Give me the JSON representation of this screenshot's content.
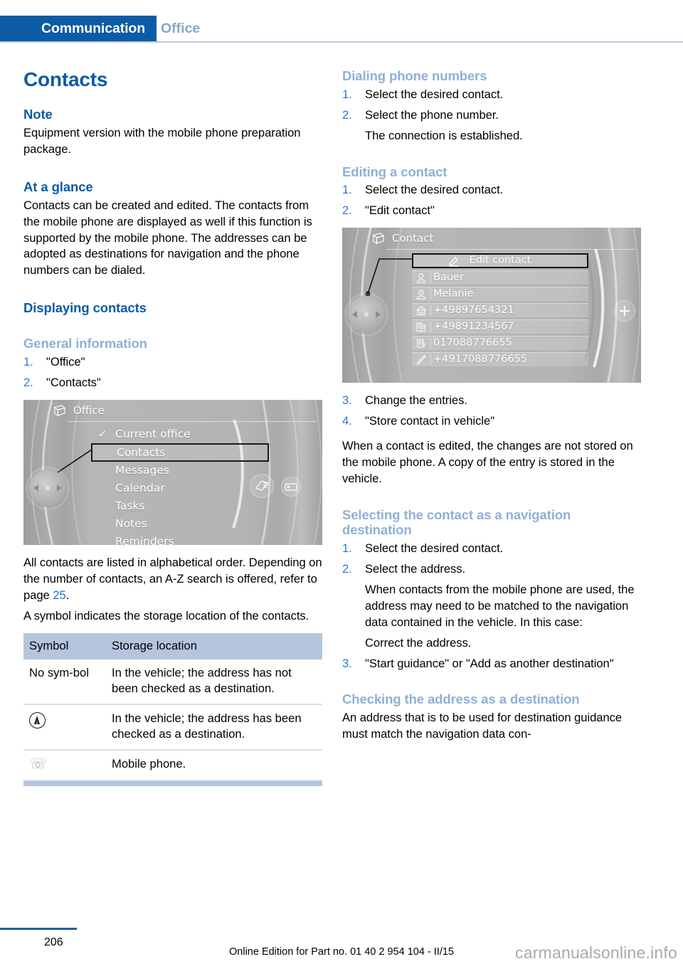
{
  "header": {
    "active_tab": "Communication",
    "inactive_tab": "Office",
    "accent_color": "#0b5ba5",
    "inactive_color": "#8ba6c9"
  },
  "left_column": {
    "title": "Contacts",
    "note_heading": "Note",
    "note_text": "Equipment version with the mobile phone preparation package.",
    "glance_heading": "At a glance",
    "glance_text": "Contacts can be created and edited. The contacts from the mobile phone are displayed as well if this function is supported by the mobile phone. The addresses can be adopted as destinations for navigation and the phone numbers can be dialed.",
    "displaying_heading": "Displaying contacts",
    "general_heading": "General information",
    "general_steps": [
      {
        "num": "1.",
        "text": "\"Office\""
      },
      {
        "num": "2.",
        "text": "\"Contacts\""
      }
    ],
    "office_screen": {
      "title": "Office",
      "items": [
        {
          "label": "Current office",
          "checked": true,
          "selected": false
        },
        {
          "label": "Contacts",
          "checked": false,
          "selected": true
        },
        {
          "label": "Messages",
          "checked": false,
          "selected": false
        },
        {
          "label": "Calendar",
          "checked": false,
          "selected": false
        },
        {
          "label": "Tasks",
          "checked": false,
          "selected": false
        },
        {
          "label": "Notes",
          "checked": false,
          "selected": false
        },
        {
          "label": "Reminders",
          "checked": false,
          "selected": false
        }
      ]
    },
    "after_image_p1_a": "All contacts are listed in alphabetical order. Depending on the number of contacts, an A-Z search is offered, refer to page ",
    "after_image_p1_page": "25",
    "after_image_p1_b": ".",
    "after_image_p2": "A symbol indicates the storage location of the contacts.",
    "table": {
      "headers": [
        "Symbol",
        "Storage location"
      ],
      "rows": [
        {
          "symbol_text": "No sym-bol",
          "symbol_icon": "",
          "location": "In the vehicle; the address has not been checked as a destination."
        },
        {
          "symbol_text": "",
          "symbol_icon": "navigation-circle-icon",
          "location": "In the vehicle; the address has been checked as a destination."
        },
        {
          "symbol_text": "",
          "symbol_icon": "mobile-phone-icon",
          "location": "Mobile phone."
        }
      ]
    }
  },
  "right_column": {
    "dialing_heading": "Dialing phone numbers",
    "dialing_steps": [
      {
        "num": "1.",
        "text": "Select the desired contact."
      },
      {
        "num": "2.",
        "text": "Select the phone number."
      },
      {
        "num": "",
        "text": "The connection is established."
      }
    ],
    "editing_heading": "Editing a contact",
    "editing_steps_before": [
      {
        "num": "1.",
        "text": "Select the desired contact."
      },
      {
        "num": "2.",
        "text": "\"Edit contact\""
      }
    ],
    "contact_screen": {
      "title": "Contact",
      "header_row": {
        "label": "Edit contact",
        "icon": "pencil-icon",
        "selected": true
      },
      "rows": [
        {
          "label": "Bauer",
          "icon": "person-icon"
        },
        {
          "label": "Melanie",
          "icon": "person-icon"
        },
        {
          "label": "+49897654321",
          "icon": "home-icon"
        },
        {
          "label": "+49891234567",
          "icon": "office-building-icon"
        },
        {
          "label": "017088776655",
          "icon": "fax-icon"
        },
        {
          "label": "+4917088776655",
          "icon": "handset-icon"
        }
      ]
    },
    "editing_steps_after": [
      {
        "num": "3.",
        "text": "Change the entries."
      },
      {
        "num": "4.",
        "text": "\"Store contact in vehicle\""
      }
    ],
    "editing_note": "When a contact is edited, the changes are not stored on the mobile phone. A copy of the entry is stored in the vehicle.",
    "selecting_heading": "Selecting the contact as a navigation destination",
    "selecting_steps": [
      {
        "num": "1.",
        "text": "Select the desired contact."
      },
      {
        "num": "2.",
        "text": "Select the address."
      },
      {
        "num": "",
        "text": "When contacts from the mobile phone are used, the address may need to be matched to the navigation data contained in the vehicle. In this case:"
      },
      {
        "num": "",
        "text": "Correct the address."
      },
      {
        "num": "3.",
        "text": "\"Start guidance\" or \"Add as another destination\""
      }
    ],
    "checking_heading": "Checking the address as a destination",
    "checking_text": "An address that is to be used for destination guidance must match the navigation data con-"
  },
  "footer": {
    "page_number": "206",
    "edition": "Online Edition for Part no. 01 40 2 954 104 - II/15",
    "watermark": "carmanualsonline.info"
  }
}
